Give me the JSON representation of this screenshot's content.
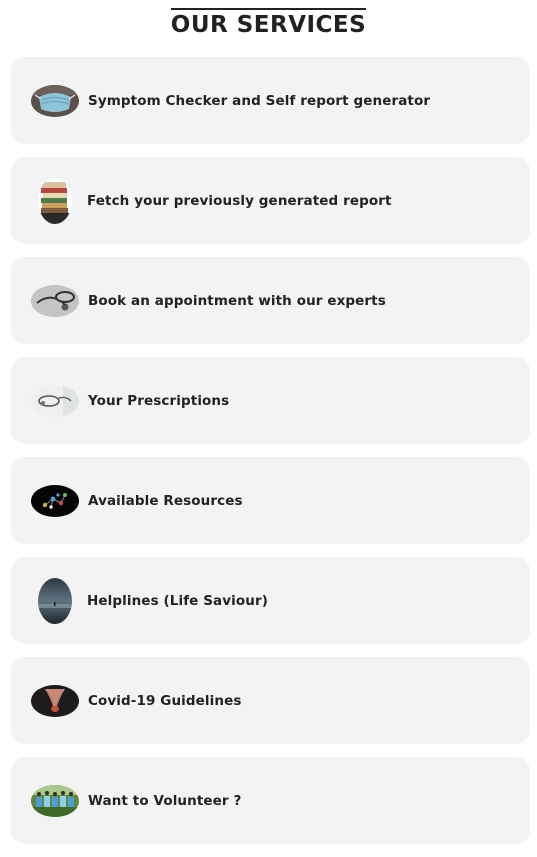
{
  "page": {
    "title": "OUR SERVICES"
  },
  "services": [
    {
      "label": "Symptom Checker and Self report generator",
      "icon": "face-mask-icon"
    },
    {
      "label": "Fetch your previously generated report",
      "icon": "files-stack-icon"
    },
    {
      "label": "Book an appointment with our experts",
      "icon": "stethoscope-icon"
    },
    {
      "label": "Your Prescriptions",
      "icon": "stethoscope-icon"
    },
    {
      "label": "Available Resources",
      "icon": "molecule-icon"
    },
    {
      "label": "Helplines (Life Saviour)",
      "icon": "misty-landscape-icon"
    },
    {
      "label": "Covid-19 Guidelines",
      "icon": "holding-hands-icon"
    },
    {
      "label": "Want to Volunteer ?",
      "icon": "volunteers-group-icon"
    }
  ],
  "colors": {
    "card_background": "#f3f3f3",
    "text": "#222222"
  }
}
